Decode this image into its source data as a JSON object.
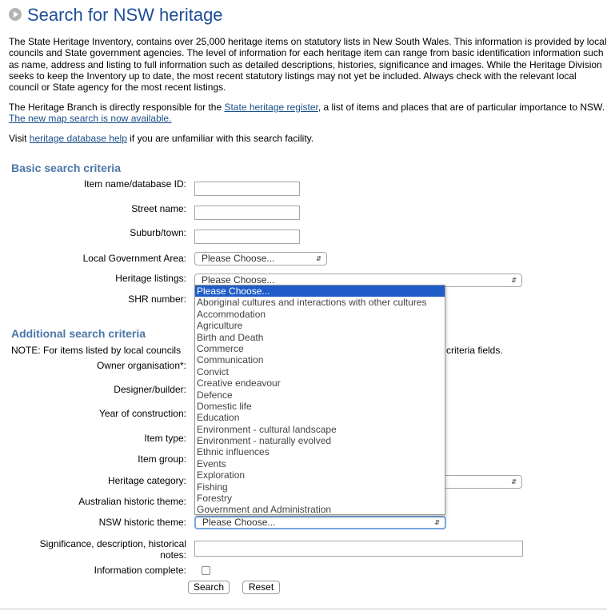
{
  "page": {
    "title": "Search for NSW heritage",
    "intro_text": "The State Heritage Inventory, contains over 25,000 heritage items on statutory lists in New South Wales. This information is provided by local councils and State government agencies. The level of information for each heritage item can range from basic identification information such as name, address and listing to full information such as detailed descriptions, histories, significance and images. While the Heritage Division seeks to keep the Inventory up to date, the most recent statutory listings may not yet be included. Always check with the relevant local council or State agency for the most recent listings.",
    "branch_text_before": "The Heritage Branch is directly responsible for the ",
    "branch_link": "State heritage register",
    "branch_text_after": ", a list of items and places that are of particular importance to NSW.",
    "map_search_link": "The new map search is now available.",
    "visit_before": "Visit ",
    "help_link": "heritage database help",
    "visit_after": " if you are unfamiliar with this search facility."
  },
  "basic": {
    "title": "Basic search criteria",
    "item_name_label": "Item name/database ID:",
    "street_label": "Street name:",
    "suburb_label": "Suburb/town:",
    "lga_label": "Local Government Area:",
    "lga_value": "Please Choose...",
    "listings_label": "Heritage listings:",
    "listings_value": "Please Choose...",
    "shr_label": "SHR number:"
  },
  "additional": {
    "title": "Additional search criteria",
    "note_left": "NOTE: For items listed by local councils",
    "note_right": "criteria fields.",
    "owner_label": "Owner organisation*:",
    "designer_label": "Designer/builder:",
    "year_label": "Year of construction:",
    "item_type_label": "Item type:",
    "item_group_label": "Item group:",
    "category_label": "Heritage category:",
    "aus_theme_label": "Australian historic theme:",
    "nsw_theme_label": "NSW historic theme:",
    "nsw_theme_value": "Please Choose...",
    "significance_label_line1": "Significance, description, historical",
    "significance_label_line2": "notes:",
    "complete_label": "Information complete:"
  },
  "dropdown_options": [
    "Please Choose...",
    "Aboriginal cultures and interactions with other cultures",
    "Accommodation",
    "Agriculture",
    "Birth and Death",
    "Commerce",
    "Communication",
    "Convict",
    "Creative endeavour",
    "Defence",
    "Domestic life",
    "Education",
    "Environment - cultural landscape",
    "Environment - naturally evolved",
    "Ethnic influences",
    "Events",
    "Exploration",
    "Fishing",
    "Forestry",
    "Government and Administration"
  ],
  "buttons": {
    "search": "Search",
    "reset": "Reset"
  },
  "colors": {
    "title": "#1e4f99",
    "section": "#4b77a8",
    "link": "#1a4e8a",
    "highlight": "#1f5cc7"
  }
}
